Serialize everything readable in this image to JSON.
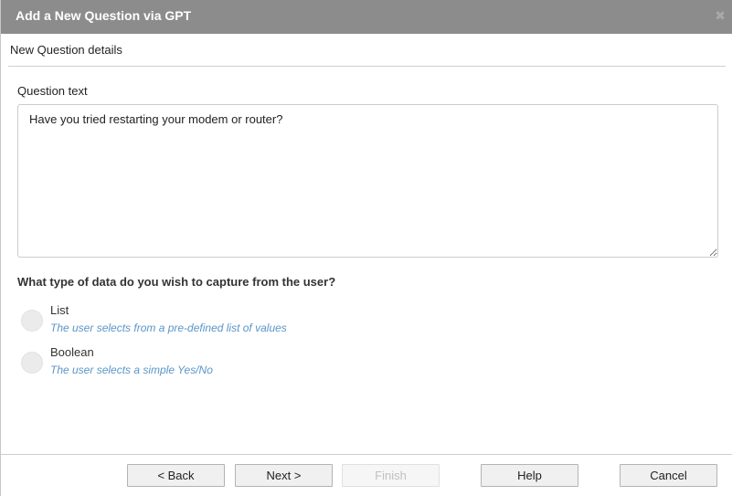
{
  "window": {
    "title": "Add a New Question via GPT",
    "close_glyph": "✖"
  },
  "section": {
    "header": "New Question details"
  },
  "question": {
    "label": "Question text",
    "value": "Have you tried restarting your modem or router?"
  },
  "data_type": {
    "label": "What type of data do you wish to capture from the user?",
    "options": [
      {
        "title": "List",
        "description": "The user selects from a pre-defined list of values",
        "selected": false
      },
      {
        "title": "Boolean",
        "description": "The user selects a simple Yes/No",
        "selected": false
      }
    ]
  },
  "footer": {
    "back_label": "< Back",
    "next_label": "Next >",
    "finish_label": "Finish",
    "finish_enabled": false,
    "help_label": "Help",
    "cancel_label": "Cancel"
  },
  "colors": {
    "titlebar": "#8c8c8c",
    "description_text": "#5b95c8",
    "radio_fill": "#ebebeb"
  }
}
